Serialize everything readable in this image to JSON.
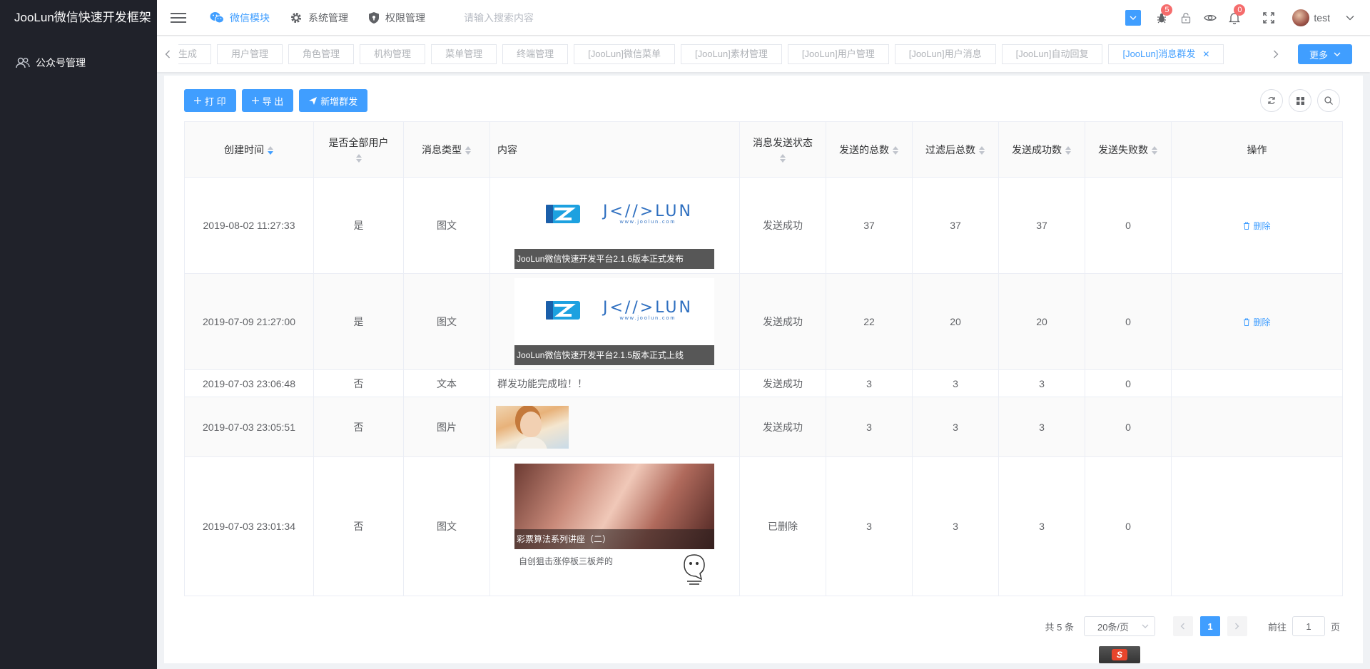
{
  "app": {
    "title": "JooLun微信快速开发框架"
  },
  "sidebar": {
    "items": [
      {
        "label": "公众号管理",
        "icon": "users-icon"
      }
    ]
  },
  "header": {
    "nav": [
      {
        "label": "微信模块",
        "icon": "wechat-icon",
        "active": true
      },
      {
        "label": "系统管理",
        "icon": "gear-icon",
        "active": false
      },
      {
        "label": "权限管理",
        "icon": "shield-icon",
        "active": false
      }
    ],
    "search_placeholder": "请输入搜索内容",
    "bug_badge": "5",
    "bell_badge": "0",
    "username": "test",
    "accent": "#409eff"
  },
  "tags": [
    {
      "label": "生成"
    },
    {
      "label": "用户管理"
    },
    {
      "label": "角色管理"
    },
    {
      "label": "机构管理"
    },
    {
      "label": "菜单管理"
    },
    {
      "label": "终端管理"
    },
    {
      "label": "[JooLun]微信菜单"
    },
    {
      "label": "[JooLun]素材管理"
    },
    {
      "label": "[JooLun]用户管理"
    },
    {
      "label": "[JooLun]用户消息"
    },
    {
      "label": "[JooLun]自动回复"
    },
    {
      "label": "[JooLun]消息群发",
      "active": true
    }
  ],
  "tags_more": "更多",
  "toolbar": {
    "print": "打 印",
    "export": "导 出",
    "add": "新增群发"
  },
  "table": {
    "columns": [
      "创建时间",
      "是否全部用户",
      "消息类型",
      "内容",
      "消息发送状态",
      "发送的总数",
      "过滤后总数",
      "发送成功数",
      "发送失败数",
      "操作"
    ],
    "delete_label": "删除",
    "logo_word": "J<//>LUN",
    "logo_url": "www.joolun.com",
    "rows": [
      {
        "time": "2019-08-02 11:27:33",
        "all": "是",
        "type": "图文",
        "caption": "JooLun微信快速开发平台2.1.6版本正式发布",
        "status": "发送成功",
        "total": "37",
        "filtered": "37",
        "success": "37",
        "fail": "0"
      },
      {
        "time": "2019-07-09 21:27:00",
        "all": "是",
        "type": "图文",
        "caption": "JooLun微信快速开发平台2.1.5版本正式上线",
        "status": "发送成功",
        "total": "22",
        "filtered": "20",
        "success": "20",
        "fail": "0"
      },
      {
        "time": "2019-07-03 23:06:48",
        "all": "否",
        "type": "文本",
        "text": "群发功能完成啦！！",
        "status": "发送成功",
        "total": "3",
        "filtered": "3",
        "success": "3",
        "fail": "0"
      },
      {
        "time": "2019-07-03 23:05:51",
        "all": "否",
        "type": "图片",
        "status": "发送成功",
        "total": "3",
        "filtered": "3",
        "success": "3",
        "fail": "0"
      },
      {
        "time": "2019-07-03 23:01:34",
        "all": "否",
        "type": "图文",
        "caption": "彩票算法系列讲座（二）",
        "sub": "自创狙击涨停板三板斧的",
        "status": "已删除",
        "total": "3",
        "filtered": "3",
        "success": "3",
        "fail": "0"
      }
    ]
  },
  "pager": {
    "total": "共 5 条",
    "size": "20条/页",
    "current": "1",
    "goto_prefix": "前往",
    "goto_value": "1",
    "goto_suffix": "页"
  }
}
